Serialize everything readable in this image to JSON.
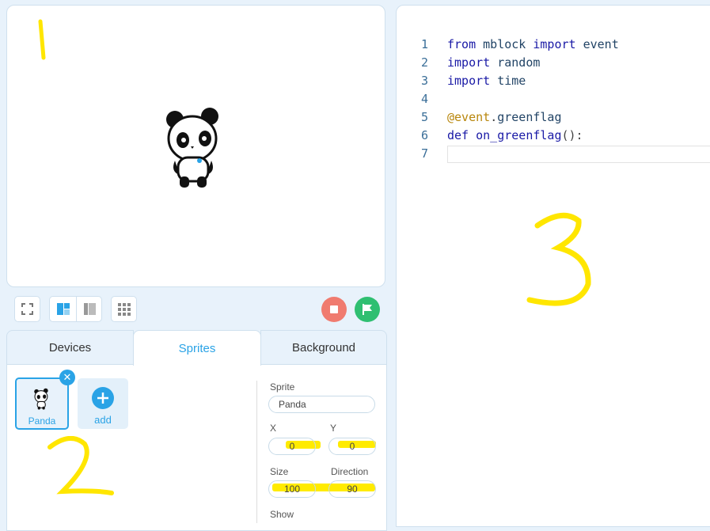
{
  "annotations": {
    "stage": "1",
    "sprites": "2",
    "editor": "3"
  },
  "tabs": [
    {
      "label": "Devices"
    },
    {
      "label": "Sprites"
    },
    {
      "label": "Background"
    }
  ],
  "sprites": {
    "items": [
      {
        "name": "Panda"
      }
    ],
    "add_label": "add"
  },
  "properties": {
    "sprite_label": "Sprite",
    "sprite_value": "Panda",
    "x_label": "X",
    "x_value": "0",
    "y_label": "Y",
    "y_value": "0",
    "size_label": "Size",
    "size_value": "100",
    "direction_label": "Direction",
    "direction_value": "90",
    "show_label": "Show"
  },
  "editor": {
    "lines": [
      {
        "n": "1",
        "tokens": [
          {
            "t": "from",
            "c": "kw"
          },
          {
            "t": " mblock ",
            "c": "id"
          },
          {
            "t": "import",
            "c": "kw"
          },
          {
            "t": " event",
            "c": "id"
          }
        ]
      },
      {
        "n": "2",
        "tokens": [
          {
            "t": "import",
            "c": "kw"
          },
          {
            "t": " random",
            "c": "id"
          }
        ]
      },
      {
        "n": "3",
        "tokens": [
          {
            "t": "import",
            "c": "kw"
          },
          {
            "t": " time",
            "c": "id"
          }
        ]
      },
      {
        "n": "4",
        "tokens": []
      },
      {
        "n": "5",
        "tokens": [
          {
            "t": "@event",
            "c": "dec"
          },
          {
            "t": ".",
            "c": "pun"
          },
          {
            "t": "greenflag",
            "c": "id"
          }
        ]
      },
      {
        "n": "6",
        "tokens": [
          {
            "t": "def",
            "c": "kw"
          },
          {
            "t": " on_greenflag",
            "c": "fn"
          },
          {
            "t": "():",
            "c": "pun"
          }
        ]
      },
      {
        "n": "7",
        "tokens": []
      }
    ]
  },
  "colors": {
    "accent": "#2aa3e6",
    "stop": "#f07b6f",
    "go": "#2fbf71",
    "highlight": "#ffeb00"
  }
}
